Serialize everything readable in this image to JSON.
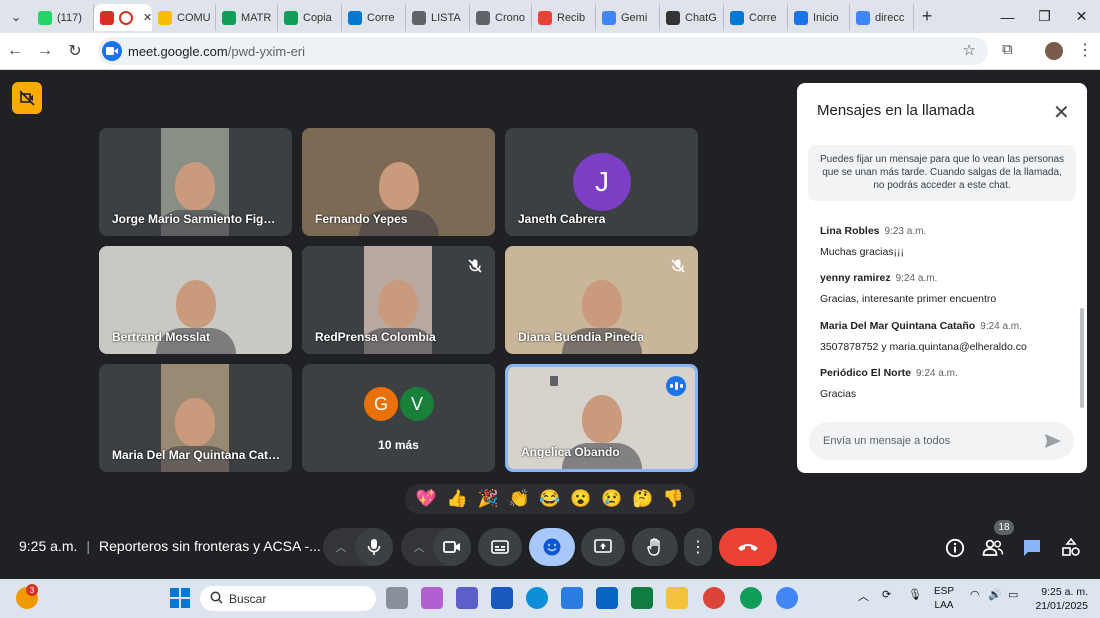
{
  "browser": {
    "tabs": [
      {
        "label": "(117)",
        "icon": "whatsapp-icon",
        "color": "#25d366"
      },
      {
        "label": "",
        "icon": "meet-recording-icon",
        "color": "#d93025",
        "active": true
      },
      {
        "label": "COMU",
        "icon": "drive-icon",
        "color": "#fbbc04"
      },
      {
        "label": "MATR",
        "icon": "sheets-icon",
        "color": "#0f9d58"
      },
      {
        "label": "Copia",
        "icon": "sheets-icon",
        "color": "#0f9d58"
      },
      {
        "label": "Corre",
        "icon": "outlook-icon",
        "color": "#0078d4"
      },
      {
        "label": "LISTA",
        "icon": "globe-icon",
        "color": "#5f6368"
      },
      {
        "label": "Crono",
        "icon": "globe-icon",
        "color": "#5f6368"
      },
      {
        "label": "Recib",
        "icon": "gmail-icon",
        "color": "#ea4335"
      },
      {
        "label": "Gemi",
        "icon": "gemini-icon",
        "color": "#4285f4"
      },
      {
        "label": "ChatG",
        "icon": "chatgpt-icon",
        "color": "#333333"
      },
      {
        "label": "Corre",
        "icon": "outlook-icon",
        "color": "#0078d4"
      },
      {
        "label": "Inicio",
        "icon": "edge-icon",
        "color": "#1a73e8"
      },
      {
        "label": "direcc",
        "icon": "google-icon",
        "color": "#4285f4"
      }
    ],
    "new_tab": "+",
    "url_domain": "meet.google.com",
    "url_path": "/pwd-yxim-eri"
  },
  "participants": [
    {
      "name": "Jorge Mario Sarmiento Figuer...",
      "type": "video",
      "bg": "#8a8f86",
      "muted": false
    },
    {
      "name": "Fernando Yepes",
      "type": "video",
      "bg": "#7d6a55",
      "muted": false
    },
    {
      "name": "Janeth Cabrera",
      "type": "avatar",
      "initial": "J",
      "color": "#7b3ec4",
      "muted": false
    },
    {
      "name": "Bertrand Mosslat",
      "type": "video",
      "bg": "#c9c8c2",
      "muted": false
    },
    {
      "name": "RedPrensa Colombia",
      "type": "video",
      "bg": "#b9a9a0",
      "muted": true
    },
    {
      "name": "Diana Buendia Pineda",
      "type": "video",
      "bg": "#c8b59a",
      "muted": true
    },
    {
      "name": "Maria Del Mar Quintana Cata...",
      "type": "video",
      "bg": "#9a8a74",
      "muted": false
    },
    {
      "name": "10 más",
      "type": "group",
      "initials": [
        "G",
        "V"
      ],
      "colors": [
        "#e8710a",
        "#188038"
      ]
    },
    {
      "name": "Angelica Obando",
      "type": "video",
      "bg": "#d7d3cc",
      "speaking": true
    }
  ],
  "chat": {
    "title": "Mensajes en la llamada",
    "pin_note": "Puedes fijar un mensaje para que lo vean las personas que se unan más tarde. Cuando salgas de la llamada, no podrás acceder a este chat.",
    "messages": [
      {
        "sender": "Lina Robles",
        "time": "9:23 a.m.",
        "text": "Muchas gracias¡¡¡"
      },
      {
        "sender": "yenny ramirez",
        "time": "9:24 a.m.",
        "text": "Gracias, interesante primer encuentro"
      },
      {
        "sender": "Maria Del Mar Quintana Cataño",
        "time": "9:24 a.m.",
        "text": "3507878752 y maria.quintana@elheraldo.co"
      },
      {
        "sender": "Periódico El Norte",
        "time": "9:24 a.m.",
        "text": "Gracias"
      }
    ],
    "input_placeholder": "Envía un mensaje a todos"
  },
  "reactions": [
    "💖",
    "👍",
    "🎉",
    "👏",
    "😂",
    "😮",
    "😢",
    "🤔",
    "👎"
  ],
  "meeting": {
    "time": "9:25 a.m.",
    "title": "Reporteros sin fronteras y ACSA -...",
    "participant_count": "18"
  },
  "taskbar": {
    "search_placeholder": "Buscar",
    "notification_count": "3",
    "language_line1": "ESP",
    "language_line2": "LAA",
    "clock_time": "9:25 a. m.",
    "clock_date": "21/01/2025"
  },
  "colors": {
    "meet_bg": "#202124",
    "tile_bg": "#3c4043",
    "leave_red": "#ea4335",
    "accent_blue": "#8ab4f8",
    "host_yellow": "#f9ab00"
  }
}
